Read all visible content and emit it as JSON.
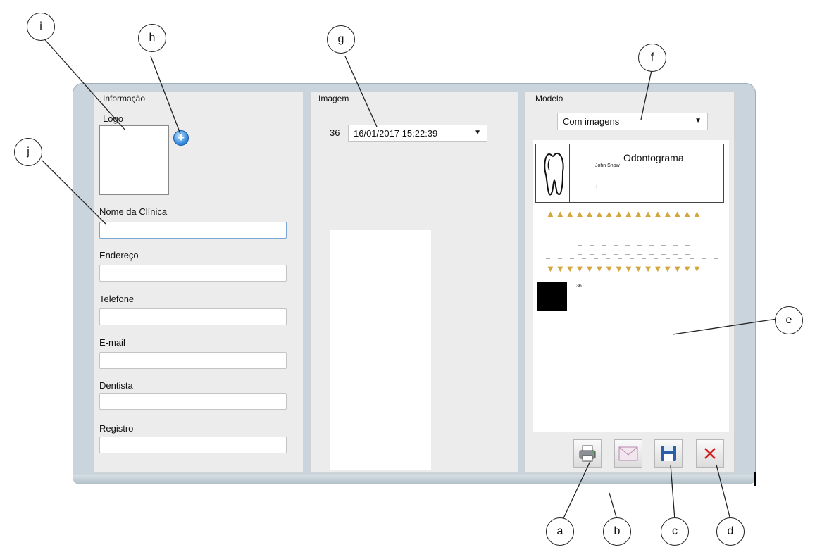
{
  "panels": {
    "informacao": {
      "title": "Informação",
      "logo_label": "Logo",
      "fields": [
        {
          "label": "Nome da Clínica",
          "value": ""
        },
        {
          "label": "Endereço",
          "value": ""
        },
        {
          "label": "Telefone",
          "value": ""
        },
        {
          "label": "E-mail",
          "value": ""
        },
        {
          "label": "Dentista",
          "value": ""
        },
        {
          "label": "Registro",
          "value": ""
        }
      ],
      "add_logo_icon": "plus-circle-icon"
    },
    "imagem": {
      "title": "Imagem",
      "image_number": "36",
      "image_date": "16/01/2017 15:22:39"
    },
    "modelo": {
      "title": "Modelo",
      "selected": "Com imagens",
      "preview": {
        "title": "Odontograma",
        "patient": "John Snow",
        "small_mark": ":",
        "image_tag": "36"
      }
    }
  },
  "buttons": {
    "print_icon": "printer-icon",
    "email_icon": "envelope-icon",
    "save_icon": "floppy-disk-icon",
    "close_icon": "close-x-icon",
    "close_color": "#d02020"
  },
  "callouts": [
    "a",
    "b",
    "c",
    "d",
    "e",
    "f",
    "g",
    "h",
    "i",
    "j"
  ]
}
